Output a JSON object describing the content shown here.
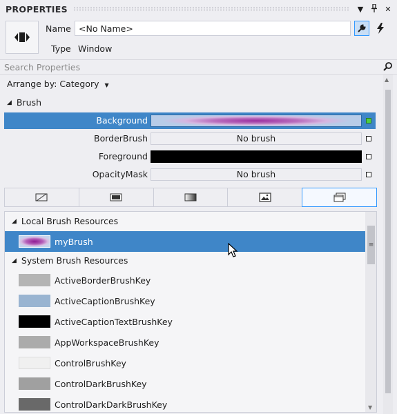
{
  "panel": {
    "title": "PROPERTIES",
    "name_label": "Name",
    "name_value": "<No Name>",
    "type_label": "Type",
    "type_value": "Window"
  },
  "search": {
    "placeholder": "Search Properties"
  },
  "arrange": {
    "label": "Arrange by: Category"
  },
  "brush": {
    "section": "Brush",
    "properties": [
      {
        "name": "Background",
        "value": "",
        "selected": true
      },
      {
        "name": "BorderBrush",
        "value": "No brush",
        "selected": false
      },
      {
        "name": "Foreground",
        "value": "",
        "selected": false
      },
      {
        "name": "OpacityMask",
        "value": "No brush",
        "selected": false
      }
    ],
    "foreground_color": "#000000"
  },
  "resources": {
    "local_header": "Local Brush Resources",
    "local_items": [
      {
        "name": "myBrush",
        "selected": true
      }
    ],
    "system_header": "System Brush Resources",
    "system_items": [
      {
        "name": "ActiveBorderBrushKey",
        "color": "#b4b4b4"
      },
      {
        "name": "ActiveCaptionBrushKey",
        "color": "#99b4d1"
      },
      {
        "name": "ActiveCaptionTextBrushKey",
        "color": "#000000"
      },
      {
        "name": "AppWorkspaceBrushKey",
        "color": "#ababab"
      },
      {
        "name": "ControlBrushKey",
        "color": "#f0f0f0"
      },
      {
        "name": "ControlDarkBrushKey",
        "color": "#a0a0a0"
      },
      {
        "name": "ControlDarkDarkBrushKey",
        "color": "#696969"
      }
    ]
  },
  "colors": {
    "selection": "#3f86c8",
    "accent": "#3399ff",
    "brush_purple": "#9b2ea0"
  }
}
